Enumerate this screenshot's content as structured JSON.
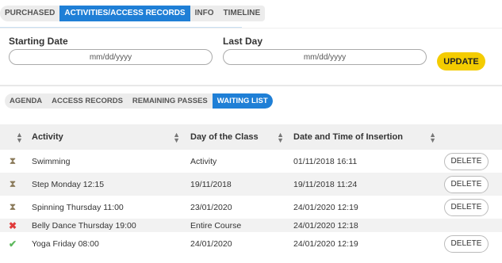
{
  "top_tabs": [
    "PURCHASED",
    "ACTIVITIES/ACCESS RECORDS",
    "INFO",
    "TIMELINE"
  ],
  "filters": {
    "start_label": "Starting Date",
    "start_placeholder": "mm/dd/yyyy",
    "end_label": "Last Day",
    "end_placeholder": "mm/dd/yyyy",
    "update_label": "UPDATE"
  },
  "sub_tabs": [
    "AGENDA",
    "ACCESS RECORDS",
    "REMAINING PASSES",
    "WAITING LIST"
  ],
  "table": {
    "headers": [
      "Activity",
      "Day of the Class",
      "Date and Time of Insertion"
    ],
    "delete_label": "DELETE",
    "rows": [
      {
        "status": "hourglass-icon",
        "activity": "Swimming",
        "day": "Activity",
        "inserted": "01/11/2018 16:11"
      },
      {
        "status": "hourglass-icon",
        "activity": "Step Monday 12:15",
        "day": "19/11/2018",
        "inserted": "19/11/2018 11:24"
      },
      {
        "status": "hourglass-icon",
        "activity": "Spinning Thursday 11:00",
        "day": "23/01/2020",
        "inserted": "24/01/2020 12:19"
      },
      {
        "status": "cross-icon",
        "activity": "Belly Dance Thursday 19:00",
        "day": "Entire Course",
        "inserted": "24/01/2020 12:18"
      },
      {
        "status": "check-icon",
        "activity": "Yoga Friday 08:00",
        "day": "24/01/2020",
        "inserted": "24/01/2020 12:19"
      }
    ]
  },
  "colors": {
    "accent": "#1f7fd6",
    "update_button": "#f4cc00",
    "cross": "#e03a3a",
    "check": "#5cb85c",
    "hourglass": "#8a7a5a"
  }
}
